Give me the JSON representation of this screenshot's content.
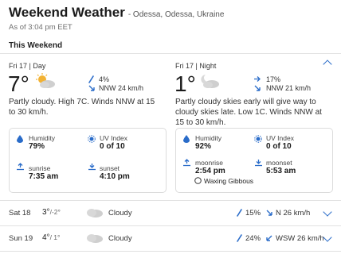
{
  "header": {
    "title": "Weekend Weather",
    "location": "- Odessa, Odessa, Ukraine",
    "as_of": "As of 3:04 pm EET"
  },
  "section_title": "This Weekend",
  "day": {
    "label": "Fri 17 | Day",
    "temp": "7°",
    "precip": "4%",
    "wind": "NNW 24 km/h",
    "description": "Partly cloudy. High 7C. Winds NNW at 15 to 30 km/h.",
    "humidity_label": "Humidity",
    "humidity": "79%",
    "uv_label": "UV Index",
    "uv": "0 of 10",
    "rise_label": "sunrise",
    "rise": "7:35 am",
    "set_label": "sunset",
    "set": "4:10 pm"
  },
  "night": {
    "label": "Fri 17 | Night",
    "temp": "1°",
    "precip": "17%",
    "wind": "NNW 21 km/h",
    "description": "Partly cloudy skies early will give way to cloudy skies late. Low 1C. Winds NNW at 15 to 30 km/h.",
    "humidity_label": "Humidity",
    "humidity": "92%",
    "uv_label": "UV Index",
    "uv": "0 of 10",
    "rise_label": "moonrise",
    "rise": "2:54 pm",
    "set_label": "moonset",
    "set": "5:53 am",
    "moon_phase": "Waxing Gibbous"
  },
  "rows": [
    {
      "day": "Sat 18",
      "high": "3°",
      "low": "/-2°",
      "condition": "Cloudy",
      "precip": "15%",
      "wind": "N 26 km/h"
    },
    {
      "day": "Sun 19",
      "high": "4°",
      "low": "/ 1°",
      "condition": "Cloudy",
      "precip": "24%",
      "wind": "WSW 26 km/h"
    }
  ],
  "colors": {
    "accent": "#2a6cc9",
    "border": "#dcdcdc",
    "sun": "#f2b233",
    "cloud": "#c9c9c9"
  }
}
